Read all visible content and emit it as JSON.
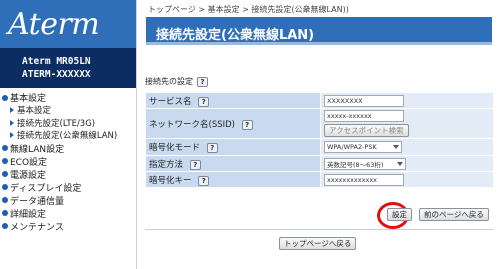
{
  "sidebar": {
    "logo": "Aterm",
    "model_line1": "Aterm  MR05LN",
    "model_line2": "ATERM-XXXXXX",
    "nav": [
      {
        "label": "基本設定",
        "subs": [
          "基本設定",
          "接続先設定(LTE/3G)",
          "接続先設定(公衆無線LAN)"
        ]
      },
      {
        "label": "無線LAN設定"
      },
      {
        "label": "ECO設定"
      },
      {
        "label": "電源設定"
      },
      {
        "label": "ディスプレイ設定"
      },
      {
        "label": "データ通信量"
      },
      {
        "label": "詳細設定"
      },
      {
        "label": "メンテナンス"
      }
    ]
  },
  "breadcrumb": "トップページ > 基本設定 > 接続先設定(公衆無線LAN))",
  "page_title": "接続先設定(公衆無線LAN)",
  "section": {
    "title": "接続先の設定",
    "help": "?"
  },
  "form": {
    "service_name_label": "サービス名",
    "service_name_value": "XXXXXXXX",
    "ssid_label": "ネットワーク名(SSID)",
    "ssid_value": "xxxxx-xxxxxx",
    "ssid_search_button": "アクセスポイント検索",
    "encryption_mode_label": "暗号化モード",
    "encryption_mode_value": "WPA/WPA2-PSK",
    "method_label": "指定方法",
    "method_value": "英数記号(8〜63桁)",
    "key_label": "暗号化キー",
    "key_value": "xxxxxxxxxxxxx"
  },
  "actions": {
    "set_button": "設定",
    "back_button": "前のページへ戻る",
    "top_button": "トップページへ戻る"
  },
  "colors": {
    "brand_blue": "#2f6fba",
    "navy": "#0b2d62",
    "label_cell": "#c9d9ef",
    "value_cell": "#e3ebf6",
    "highlight": "#e01010"
  }
}
